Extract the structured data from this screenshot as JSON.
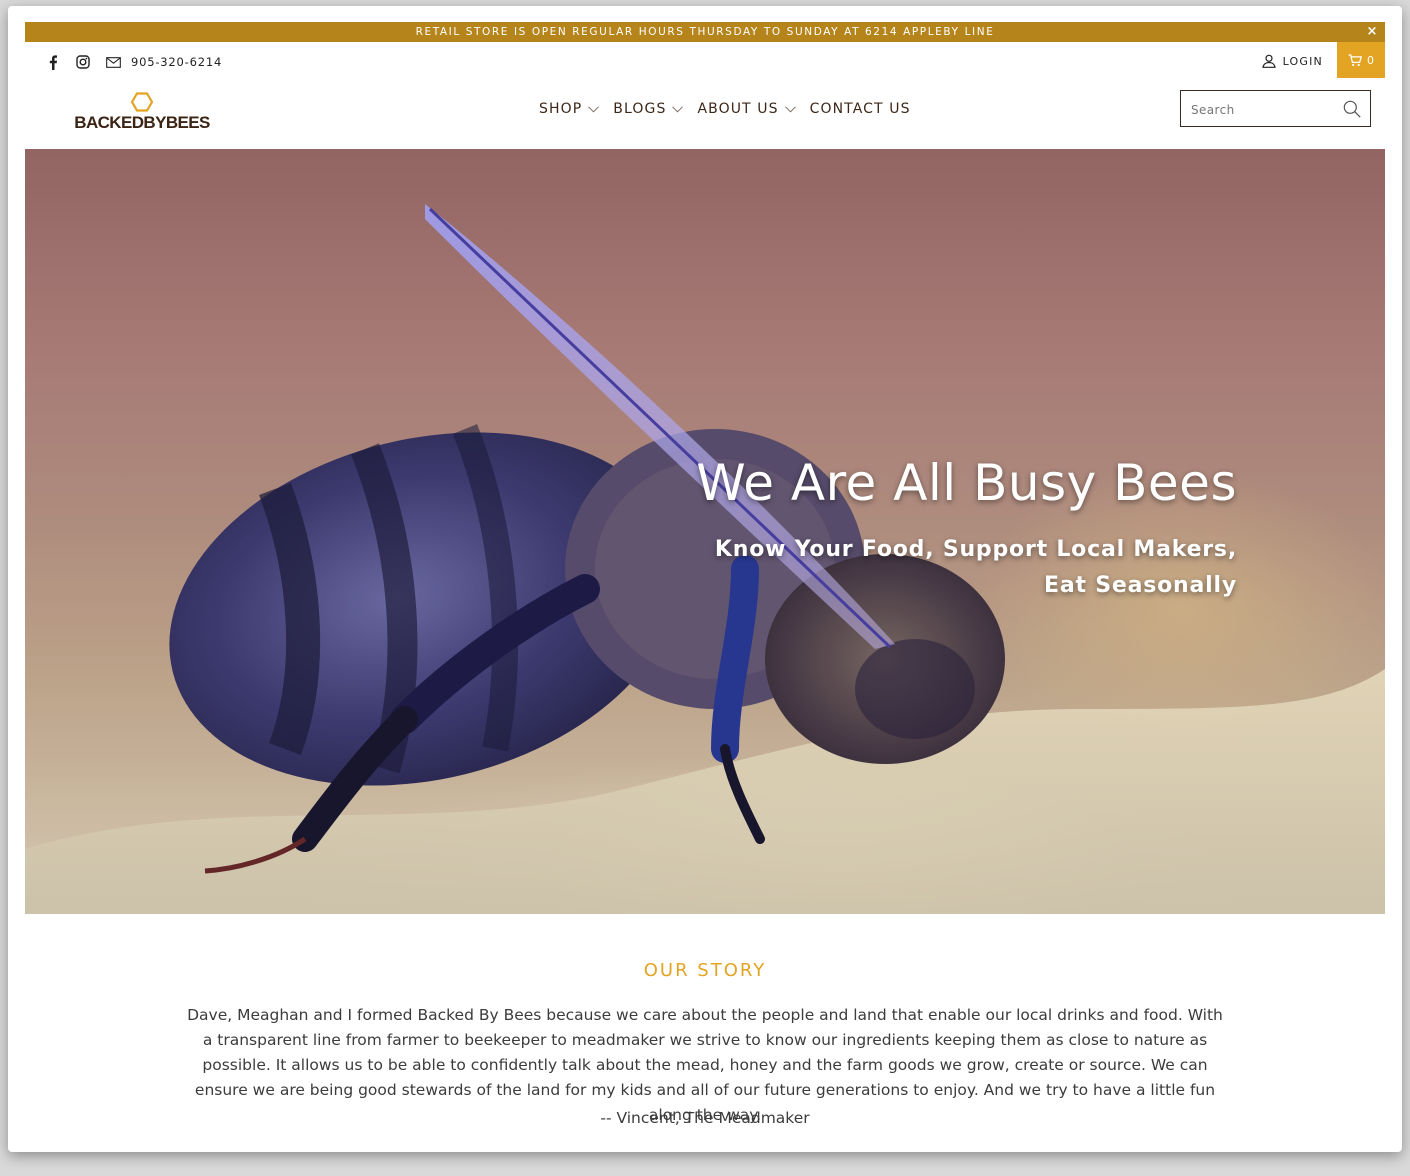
{
  "announcement": {
    "text": "RETAIL STORE IS OPEN REGULAR HOURS THURSDAY TO SUNDAY AT 6214 APPLEBY LINE",
    "close_symbol": "×"
  },
  "utility": {
    "phone": "905-320-6214",
    "social_icons": [
      "facebook-icon",
      "instagram-icon",
      "mail-icon"
    ],
    "login_label": "LOGIN",
    "cart_count": "0"
  },
  "header": {
    "logo_text": "BACKEDBYBEES",
    "nav": [
      {
        "label": "SHOP",
        "has_dropdown": true
      },
      {
        "label": "BLOGS",
        "has_dropdown": true
      },
      {
        "label": "ABOUT US",
        "has_dropdown": true
      },
      {
        "label": "CONTACT US",
        "has_dropdown": false
      }
    ],
    "search_placeholder": "Search"
  },
  "hero": {
    "heading": "We Are All Busy Bees",
    "subheading": "Know Your Food, Support Local Makers, Eat Seasonally"
  },
  "story": {
    "title": "OUR STORY",
    "body": "Dave, Meaghan and I formed Backed By Bees because we care about the people and land that enable our local drinks and food. With a transparent line from farmer to beekeeper to meadmaker we strive to know our ingredients keeping them as close to nature as possible. It allows us to be able to confidently talk about the mead, honey and the farm goods we grow, create or source.  We can ensure we are being good stewards of the land for my kids and all of our future generations to enjoy. And we try to have a little fun along the way.",
    "signature": "-- Vincent, The Meadmaker"
  },
  "colors": {
    "announcement_bg": "#b5851c",
    "accent": "#e3a424",
    "nav_text": "#3d2718"
  }
}
